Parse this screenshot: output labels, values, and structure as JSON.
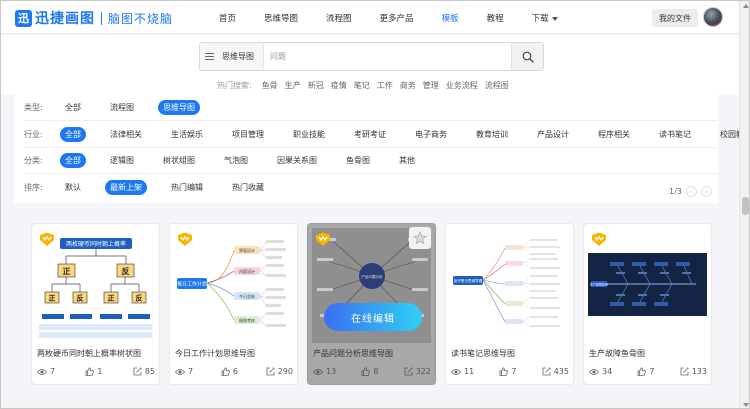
{
  "header": {
    "logo_icon": "迅",
    "logo_name": "迅捷画图",
    "logo_slogan": "脑图不烧脑",
    "nav": [
      "首页",
      "思维导图",
      "流程图",
      "更多产品",
      "模板",
      "教程",
      "下载"
    ],
    "nav_active": "模板",
    "my_files": "我的文件"
  },
  "search": {
    "category": "思维导图",
    "placeholder": "问题",
    "hot_label": "热门搜索:",
    "hot_terms": [
      "鱼骨",
      "生产",
      "新冠",
      "疫情",
      "笔记",
      "工作",
      "商务",
      "管理",
      "业务流程",
      "流程图"
    ]
  },
  "filters": {
    "type": {
      "label": "类型:",
      "options": [
        "全部",
        "流程图",
        "思维导图"
      ],
      "active": "思维导图"
    },
    "industry": {
      "label": "行业:",
      "options": [
        "全部",
        "法律相关",
        "生活娱乐",
        "项目管理",
        "职业技能",
        "考研考证",
        "电子商务",
        "教育培训",
        "产品设计",
        "程序相关",
        "读书笔记",
        "校园教育"
      ],
      "active": "全部"
    },
    "category": {
      "label": "分类:",
      "options": [
        "全部",
        "逻辑图",
        "树状组图",
        "气泡图",
        "因果关系图",
        "鱼骨图",
        "其他"
      ],
      "active": "全部"
    },
    "sort": {
      "label": "排序:",
      "options": [
        "默认",
        "最新上架",
        "热门编辑",
        "热门收藏"
      ],
      "active": "最新上架"
    },
    "page": "1/3",
    "prev_icon": "‹",
    "next_icon": "›"
  },
  "cards": [
    {
      "title": "两枚硬币同时朝上概率树状图",
      "views": "7",
      "likes": "1",
      "edits": "85",
      "thumb_title": "两枚硬币同时朝上概率",
      "thumb_nodes": [
        "正",
        "反",
        "正",
        "反",
        "正",
        "反"
      ]
    },
    {
      "title": "今日工作计划思维导图",
      "views": "7",
      "likes": "6",
      "edits": "290",
      "thumb_center": "每日工作计划",
      "thumb_nodes": [
        "界面设计",
        "内容设计",
        "今日总结",
        "绩效考核"
      ]
    },
    {
      "title": "产品问题分析思维导图",
      "views": "13",
      "likes": "8",
      "edits": "322",
      "edit_label": "在线编辑",
      "thumb_center": "产品问题分析"
    },
    {
      "title": "读书笔记思维导图",
      "views": "11",
      "likes": "7",
      "edits": "435",
      "thumb_center": "读书笔记思维导图"
    },
    {
      "title": "生产故障鱼骨图",
      "views": "34",
      "likes": "7",
      "edits": "133",
      "thumb_center": "生产故障鱼骨"
    }
  ],
  "colors": {
    "accent": "#1d78f2",
    "vip": "#f7b500",
    "overlay": "#a8a8a8"
  }
}
